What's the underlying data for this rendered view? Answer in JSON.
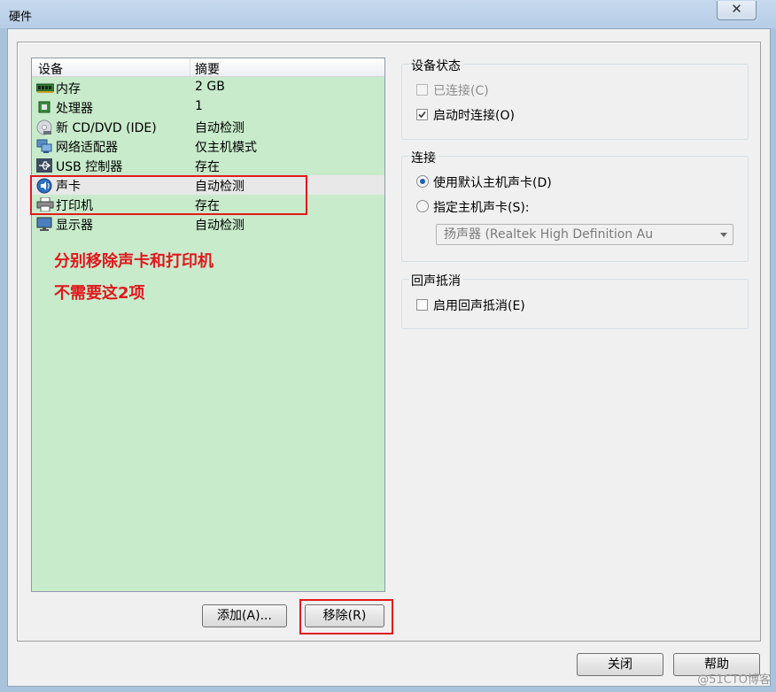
{
  "window": {
    "title": "硬件",
    "close_glyph": "✕"
  },
  "device_list": {
    "columns": [
      "设备",
      "摘要"
    ],
    "rows": [
      {
        "name": "内存",
        "summary": "2 GB",
        "icon": "memory-icon"
      },
      {
        "name": "处理器",
        "summary": "1",
        "icon": "processor-icon"
      },
      {
        "name": "新 CD/DVD (IDE)",
        "summary": "自动检测",
        "icon": "cd-dvd-icon"
      },
      {
        "name": "网络适配器",
        "summary": "仅主机模式",
        "icon": "network-adapter-icon"
      },
      {
        "name": "USB 控制器",
        "summary": "存在",
        "icon": "usb-icon"
      },
      {
        "name": "声卡",
        "summary": "自动检测",
        "icon": "sound-card-icon",
        "selected": true
      },
      {
        "name": "打印机",
        "summary": "存在",
        "icon": "printer-icon"
      },
      {
        "name": "显示器",
        "summary": "自动检测",
        "icon": "display-icon"
      }
    ]
  },
  "annotation": {
    "line1": "分别移除声卡和打印机",
    "line2": "不需要这2项",
    "color": "#e0181d"
  },
  "buttons": {
    "add": "添加(A)...",
    "remove": "移除(R)",
    "close": "关闭",
    "help": "帮助"
  },
  "device_status": {
    "title": "设备状态",
    "connected": {
      "label": "已连接(C)",
      "checked": false,
      "disabled": true
    },
    "connect_at_power_on": {
      "label": "启动时连接(O)",
      "checked": true
    }
  },
  "connection": {
    "title": "连接",
    "use_default": {
      "label": "使用默认主机声卡(D)",
      "selected": true
    },
    "specify": {
      "label": "指定主机声卡(S):",
      "selected": false
    },
    "combo_value": "扬声器 (Realtek High Definition Au"
  },
  "echo_cancel": {
    "title": "回声抵消",
    "enable": {
      "label": "启用回声抵消(E)",
      "checked": false
    }
  },
  "watermark": "@51CTO博客"
}
